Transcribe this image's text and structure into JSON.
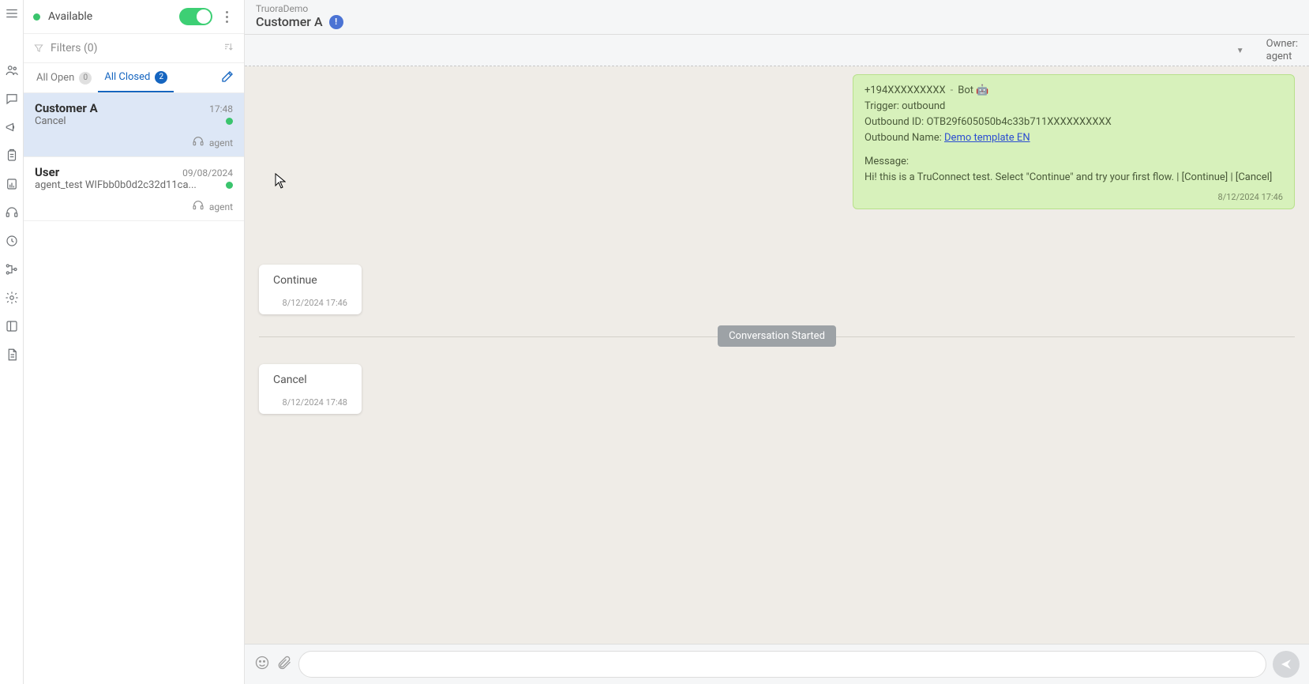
{
  "presence": {
    "label": "Available"
  },
  "filters": {
    "label": "Filters (0)"
  },
  "tabs": {
    "open": {
      "label": "All Open",
      "count": "0"
    },
    "closed": {
      "label": "All Closed",
      "count": "2"
    }
  },
  "conversations": [
    {
      "name": "Customer A",
      "time": "17:48",
      "subtitle": "Cancel",
      "agent": "agent"
    },
    {
      "name": "User",
      "time": "09/08/2024",
      "subtitle": "agent_test WIFbb0b0d2c32d11ca...",
      "agent": "agent"
    }
  ],
  "header": {
    "workspace": "TruoraDemo",
    "title": "Customer A",
    "badge": "!",
    "owner_label": "Owner:",
    "owner_value": "agent"
  },
  "bot_card": {
    "phone": "+194XXXXXXXXX",
    "dash": "-",
    "bot": "Bot 🤖",
    "trigger_label": "Trigger:",
    "trigger_value": "outbound",
    "outbound_id_label": "Outbound ID:",
    "outbound_id_value": "OTB29f605050b4c33b711XXXXXXXXXX",
    "outbound_name_label": "Outbound Name:",
    "outbound_name_value": "Demo template EN",
    "message_label": "Message:",
    "message_body": "Hi! this is a TruConnect test. Select \"Continue\" and try your first flow. | [Continue] | [Cancel]",
    "time": "8/12/2024 17:46"
  },
  "bubbles": {
    "continue": {
      "text": "Continue",
      "time": "8/12/2024 17:46"
    },
    "cancel": {
      "text": "Cancel",
      "time": "8/12/2024 17:48"
    }
  },
  "divider": {
    "label": "Conversation Started"
  },
  "composer": {
    "placeholder": ""
  }
}
